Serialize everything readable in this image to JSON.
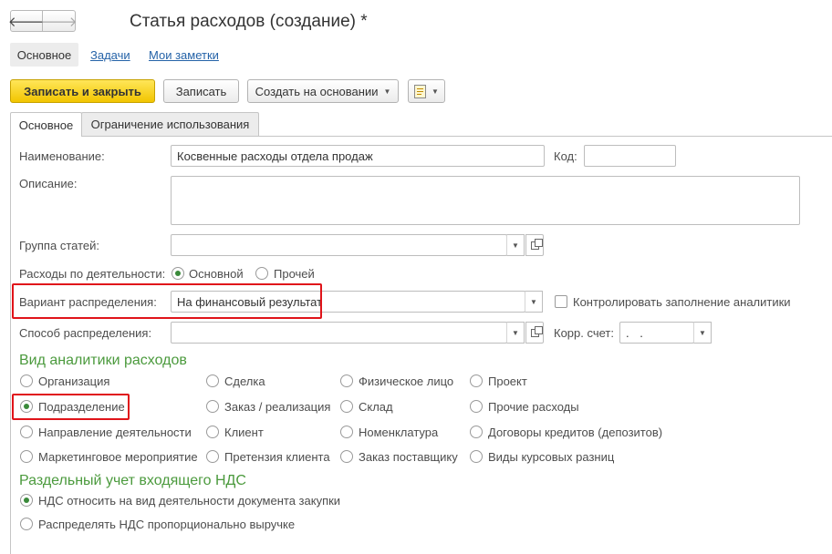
{
  "window": {
    "title": "Статья расходов (создание) *",
    "back_icon": "arrow-left-icon",
    "forward_icon": "arrow-right-icon"
  },
  "nav": {
    "main": "Основное",
    "tasks": "Задачи",
    "notes": "Мои заметки"
  },
  "toolbar": {
    "save_close": "Записать и закрыть",
    "save": "Записать",
    "create_based": "Создать на основании",
    "report_icon": "document-report-icon"
  },
  "tabs": [
    {
      "label": "Основное",
      "active": true
    },
    {
      "label": "Ограничение использования",
      "active": false
    }
  ],
  "form": {
    "name_label": "Наименование:",
    "name_value": "Косвенные расходы отдела продаж",
    "code_label": "Код:",
    "code_value": "",
    "description_label": "Описание:",
    "description_value": "",
    "group_label": "Группа статей:",
    "group_value": "",
    "activity_label": "Расходы по деятельности:",
    "activity_options": [
      "Основной",
      "Прочей"
    ],
    "activity_selected": "Основной",
    "variant_label": "Вариант распределения:",
    "variant_value": "На финансовый результат",
    "control_label": "Контролировать заполнение аналитики",
    "control_checked": false,
    "method_label": "Способ распределения:",
    "method_value": "",
    "corr_label": "Корр. счет:",
    "corr_value": ". ."
  },
  "analytics": {
    "title": "Вид аналитики расходов",
    "selected": "Подразделение",
    "options": [
      "Организация",
      "Сделка",
      "Физическое лицо",
      "Проект",
      "Подразделение",
      "Заказ / реализация",
      "Склад",
      "Прочие расходы",
      "Направление деятельности",
      "Клиент",
      "Номенклатура",
      "Договоры кредитов (депозитов)",
      "Маркетинговое мероприятие",
      "Претензия клиента",
      "Заказ поставщику",
      "Виды курсовых разниц"
    ]
  },
  "vat": {
    "title": "Раздельный учет входящего НДС",
    "options": [
      "НДС относить на вид деятельности документа закупки",
      "Распределять НДС пропорционально выручке"
    ],
    "selected": "НДС относить на вид деятельности документа закупки"
  },
  "colors": {
    "accent_green": "#4b9a3d",
    "highlight_red": "#e0141a",
    "primary_button": "#f2c500",
    "link_blue": "#2563a8"
  }
}
